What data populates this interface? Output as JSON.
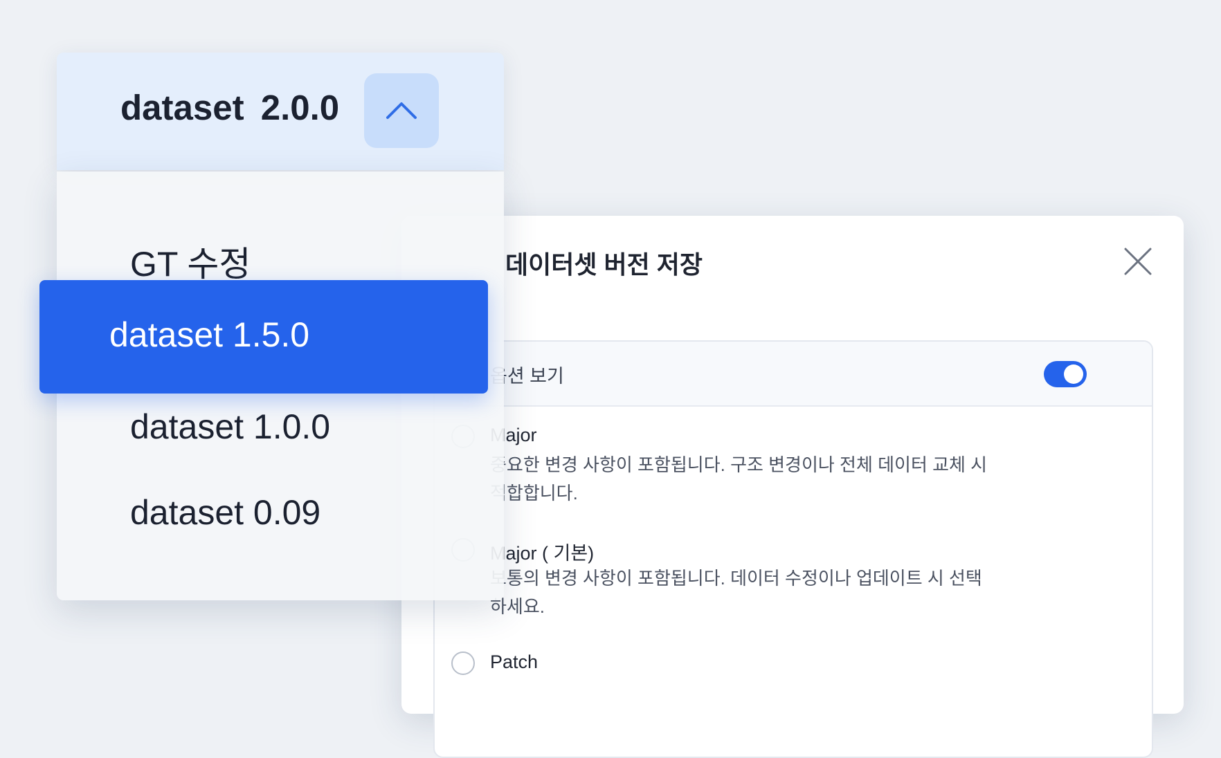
{
  "modal": {
    "title": "데이터셋 버전 저장",
    "close_icon": "close-icon",
    "options_header": "옵션 보기",
    "options_toggle_on": true,
    "options": [
      {
        "name": "Major",
        "description": "중요한 변경 사항이 포함됩니다. 구조 변경이나 전체 데이터 교체 시 적합합니다.",
        "selected": false
      },
      {
        "name": "Major ( 기본)",
        "description": "보통의 변경 사항이 포함됩니다. 데이터 수정이나 업데이트 시 선택하세요.",
        "selected": false
      },
      {
        "name": "Patch",
        "description": "",
        "selected": false
      }
    ]
  },
  "dropdown": {
    "current_value": "dataset 2.0.0",
    "toggle_icon": "chevron-up-icon",
    "items": [
      "GT 수정",
      "dataset 1.5.0",
      "dataset 1.0.0",
      "dataset 0.09"
    ],
    "highlighted": "dataset 1.5.0"
  },
  "colors": {
    "accent": "#2563eb",
    "header_bg": "#e4eefc",
    "toggle_bg": "#c8ddfb",
    "background": "#eef1f5"
  }
}
